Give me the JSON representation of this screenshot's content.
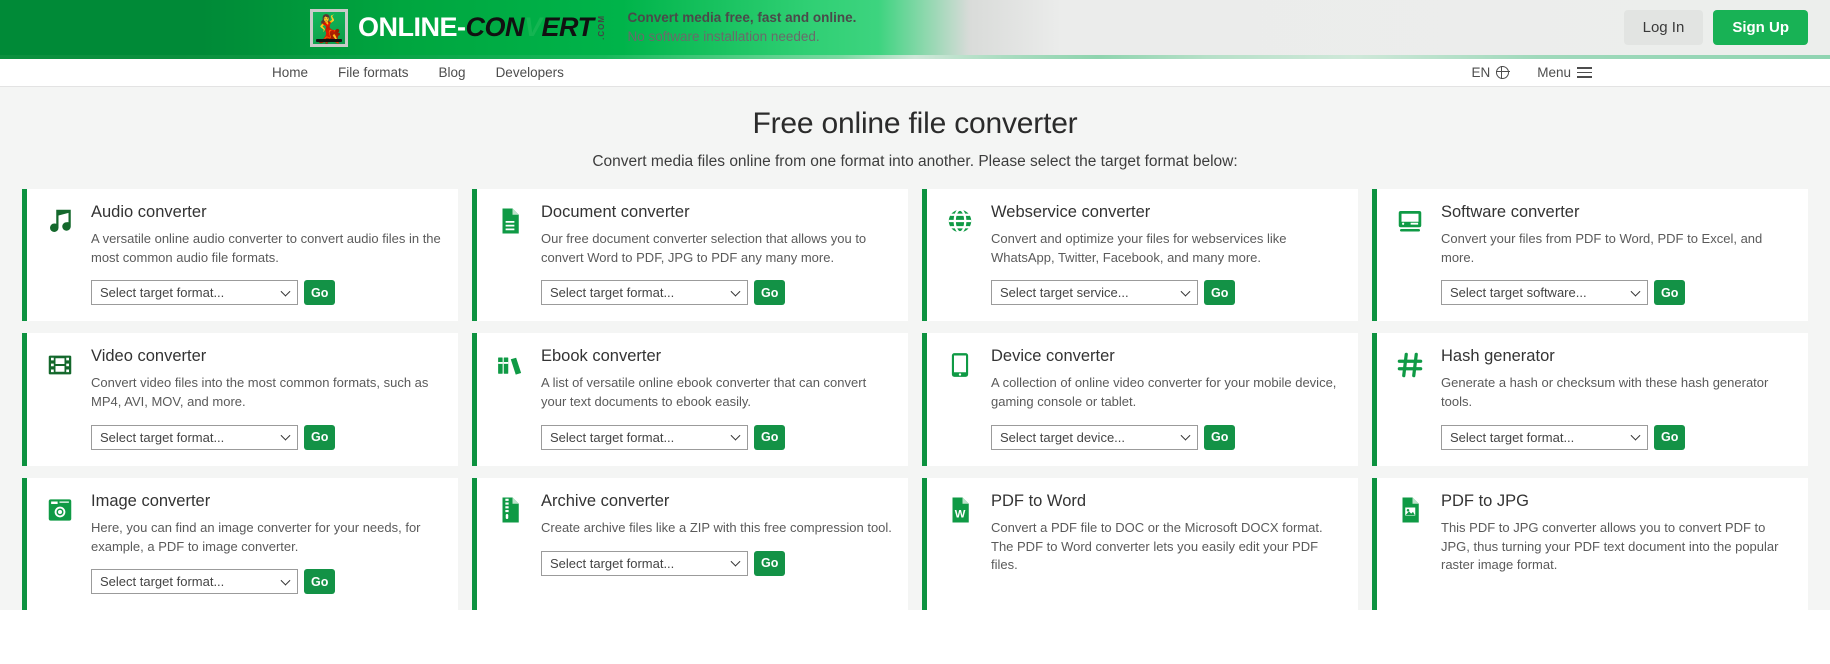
{
  "header": {
    "logo": {
      "part1": "ONLINE-",
      "part2": "CON",
      "part3": "V",
      "part4": "ERT",
      "domain": ".COM"
    },
    "tagline_line1": "Convert media free, fast and online.",
    "tagline_line2": "No software installation needed.",
    "login_label": "Log In",
    "signup_label": "Sign Up",
    "accent_green": "#0d9240",
    "signup_green": "#18b255"
  },
  "nav": {
    "items": [
      {
        "label": "Home"
      },
      {
        "label": "File formats"
      },
      {
        "label": "Blog"
      },
      {
        "label": "Developers"
      }
    ],
    "language": "EN",
    "menu_label": "Menu"
  },
  "hero": {
    "title": "Free online file converter",
    "subtitle": "Convert media files online from one format into another. Please select the target format below:"
  },
  "cards": [
    {
      "id": "audio-converter",
      "icon": "music-note-icon",
      "icon_glyph": "♫",
      "icon_dark": true,
      "title": "Audio converter",
      "desc": "A versatile online audio converter to convert audio files in the most common audio file formats.",
      "select_label": "Select target format...",
      "go_label": "Go",
      "has_controls": true
    },
    {
      "id": "document-converter",
      "icon": "document-icon",
      "icon_glyph": "📄",
      "icon_dark": false,
      "title": "Document converter",
      "desc": "Our free document converter selection that allows you to convert Word to PDF, JPG to PDF any many more.",
      "select_label": "Select target format...",
      "go_label": "Go",
      "has_controls": true
    },
    {
      "id": "webservice-converter",
      "icon": "globe-icon",
      "icon_glyph": "🌐",
      "icon_dark": false,
      "title": "Webservice converter",
      "desc": "Convert and optimize your files for webservices like WhatsApp, Twitter, Facebook, and many more.",
      "select_label": "Select target service...",
      "go_label": "Go",
      "has_controls": true
    },
    {
      "id": "software-converter",
      "icon": "monitor-icon",
      "icon_glyph": "🖵",
      "icon_dark": false,
      "title": "Software converter",
      "desc": "Convert your files from PDF to Word, PDF to Excel, and more.",
      "select_label": "Select target software...",
      "go_label": "Go",
      "has_controls": true
    },
    {
      "id": "video-converter",
      "icon": "film-strip-icon",
      "icon_glyph": "🎞",
      "icon_dark": true,
      "title": "Video converter",
      "desc": "Convert video files into the most common formats, such as MP4, AVI, MOV, and more.",
      "select_label": "Select target format...",
      "go_label": "Go",
      "has_controls": true
    },
    {
      "id": "ebook-converter",
      "icon": "books-icon",
      "icon_glyph": "📚",
      "icon_dark": false,
      "title": "Ebook converter",
      "desc": "A list of versatile online ebook converter that can convert your text documents to ebook easily.",
      "select_label": "Select target format...",
      "go_label": "Go",
      "has_controls": true
    },
    {
      "id": "device-converter",
      "icon": "tablet-icon",
      "icon_glyph": "📱",
      "icon_dark": false,
      "title": "Device converter",
      "desc": "A collection of online video converter for your mobile device, gaming console or tablet.",
      "select_label": "Select target device...",
      "go_label": "Go",
      "has_controls": true
    },
    {
      "id": "hash-generator",
      "icon": "hash-icon",
      "icon_glyph": "#",
      "icon_dark": false,
      "title": "Hash generator",
      "desc": "Generate a hash or checksum with these hash generator tools.",
      "select_label": "Select target format...",
      "go_label": "Go",
      "has_controls": true
    },
    {
      "id": "image-converter",
      "icon": "camera-icon",
      "icon_glyph": "📷",
      "icon_dark": false,
      "title": "Image converter",
      "desc": "Here, you can find an image converter for your needs, for example, a PDF to image converter.",
      "select_label": "Select target format...",
      "go_label": "Go",
      "has_controls": true
    },
    {
      "id": "archive-converter",
      "icon": "zip-file-icon",
      "icon_glyph": "🗜",
      "icon_dark": false,
      "title": "Archive converter",
      "desc": "Create archive files like a ZIP with this free compression tool.",
      "select_label": "Select target format...",
      "go_label": "Go",
      "has_controls": true
    },
    {
      "id": "pdf-to-word",
      "icon": "word-file-icon",
      "icon_glyph": "W",
      "icon_dark": false,
      "title": "PDF to Word",
      "desc": "Convert a PDF file to DOC or the Microsoft DOCX format. The PDF to Word converter lets you easily edit your PDF files.",
      "select_label": "",
      "go_label": "",
      "has_controls": false
    },
    {
      "id": "pdf-to-jpg",
      "icon": "image-file-icon",
      "icon_glyph": "🖼",
      "icon_dark": false,
      "title": "PDF to JPG",
      "desc": "This PDF to JPG converter allows you to convert PDF to JPG, thus turning your PDF text document into the popular raster image format.",
      "select_label": "",
      "go_label": "",
      "has_controls": false
    }
  ]
}
